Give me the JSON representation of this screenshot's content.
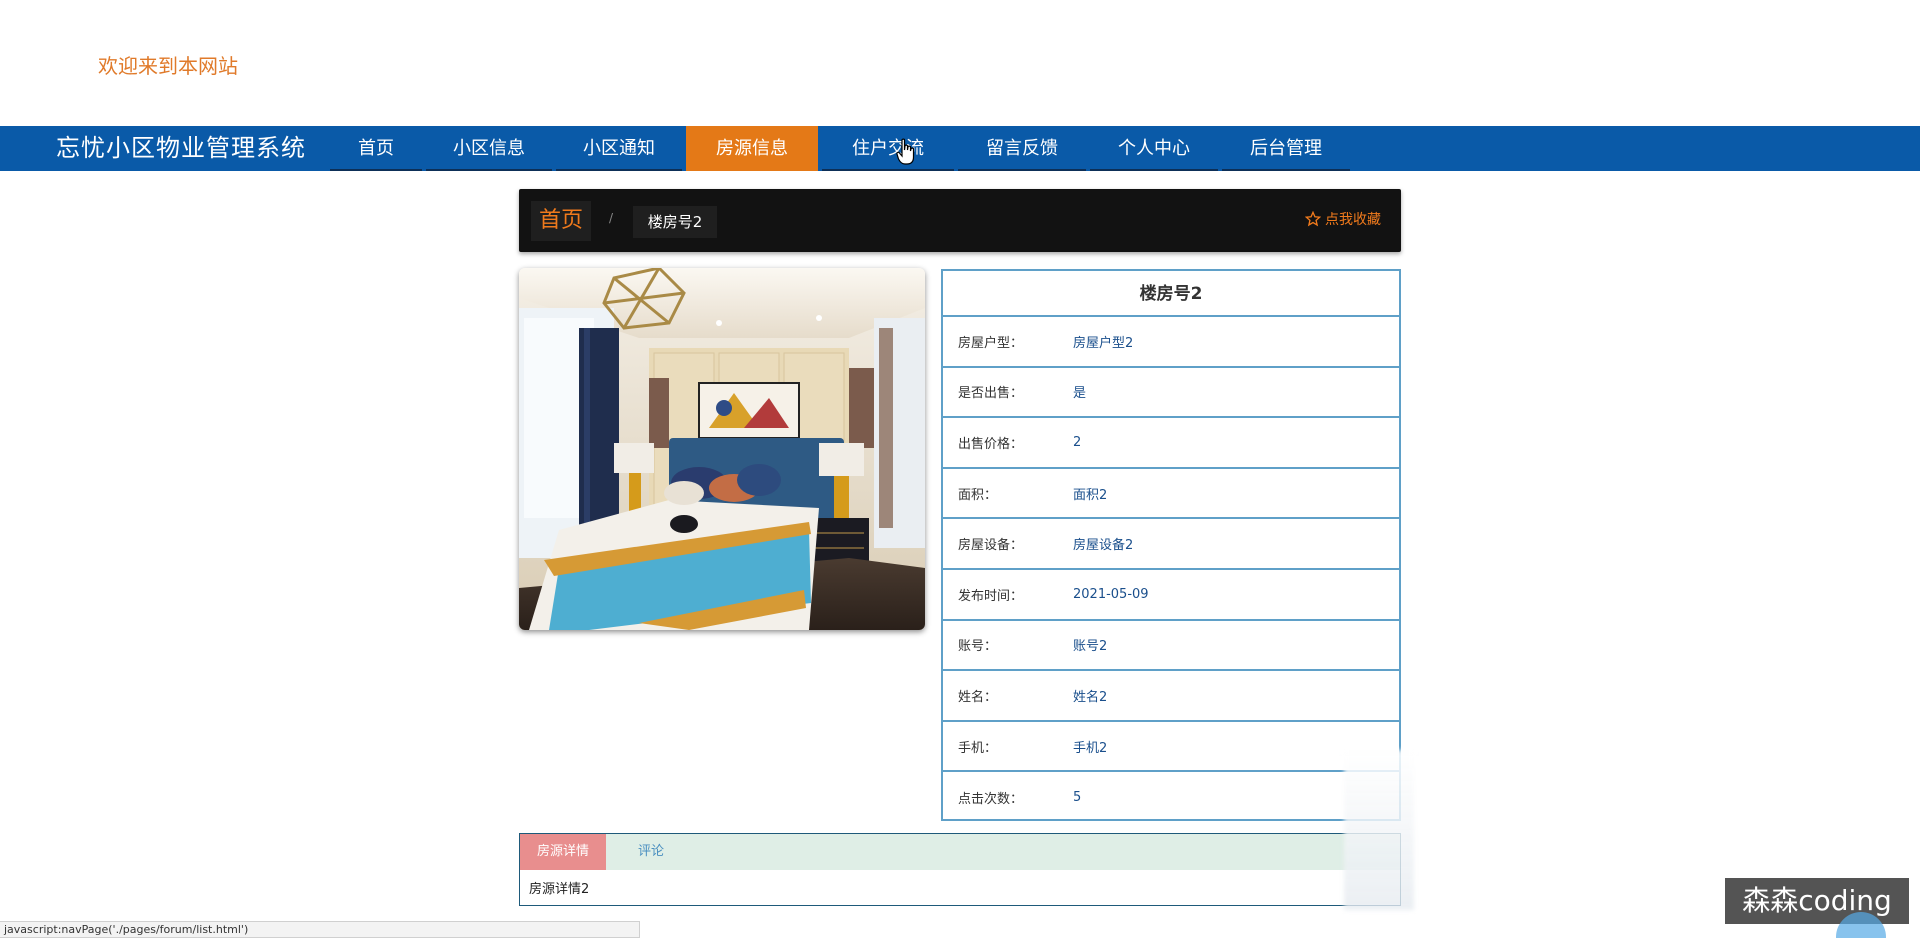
{
  "header": {
    "welcome": "欢迎来到本网站"
  },
  "nav": {
    "brand": "忘忧小区物业管理系统",
    "items": [
      {
        "label": "首页"
      },
      {
        "label": "小区信息"
      },
      {
        "label": "小区通知"
      },
      {
        "label": "房源信息"
      },
      {
        "label": "住户交流"
      },
      {
        "label": "留言反馈"
      },
      {
        "label": "个人中心"
      },
      {
        "label": "后台管理"
      }
    ],
    "active_index": 3
  },
  "breadcrumb": {
    "home": "首页",
    "separator": "/",
    "current": "楼房号2",
    "favorite": "点我收藏"
  },
  "detail": {
    "title": "楼房号2",
    "rows": [
      {
        "label": "房屋户型：",
        "value": "房屋户型2"
      },
      {
        "label": "是否出售：",
        "value": "是"
      },
      {
        "label": "出售价格：",
        "value": "2"
      },
      {
        "label": "面积：",
        "value": "面积2"
      },
      {
        "label": "房屋设备：",
        "value": "房屋设备2"
      },
      {
        "label": "发布时间：",
        "value": "2021-05-09"
      },
      {
        "label": "账号：",
        "value": "账号2"
      },
      {
        "label": "姓名：",
        "value": "姓名2"
      },
      {
        "label": "手机：",
        "value": "手机2"
      },
      {
        "label": "点击次数：",
        "value": "5"
      }
    ]
  },
  "tabs": {
    "items": [
      {
        "label": "房源详情"
      },
      {
        "label": "评论"
      }
    ],
    "content": "房源详情2"
  },
  "statusbar": {
    "url": "javascript:navPage('./pages/forum/list.html')"
  },
  "watermark": {
    "text": "森森coding"
  },
  "colors": {
    "nav_bg": "#0a5aa8",
    "accent_orange": "#e47917",
    "table_border": "#5fa0c8",
    "value_blue": "#1a4f8c",
    "tab_active": "#e88e8e"
  }
}
